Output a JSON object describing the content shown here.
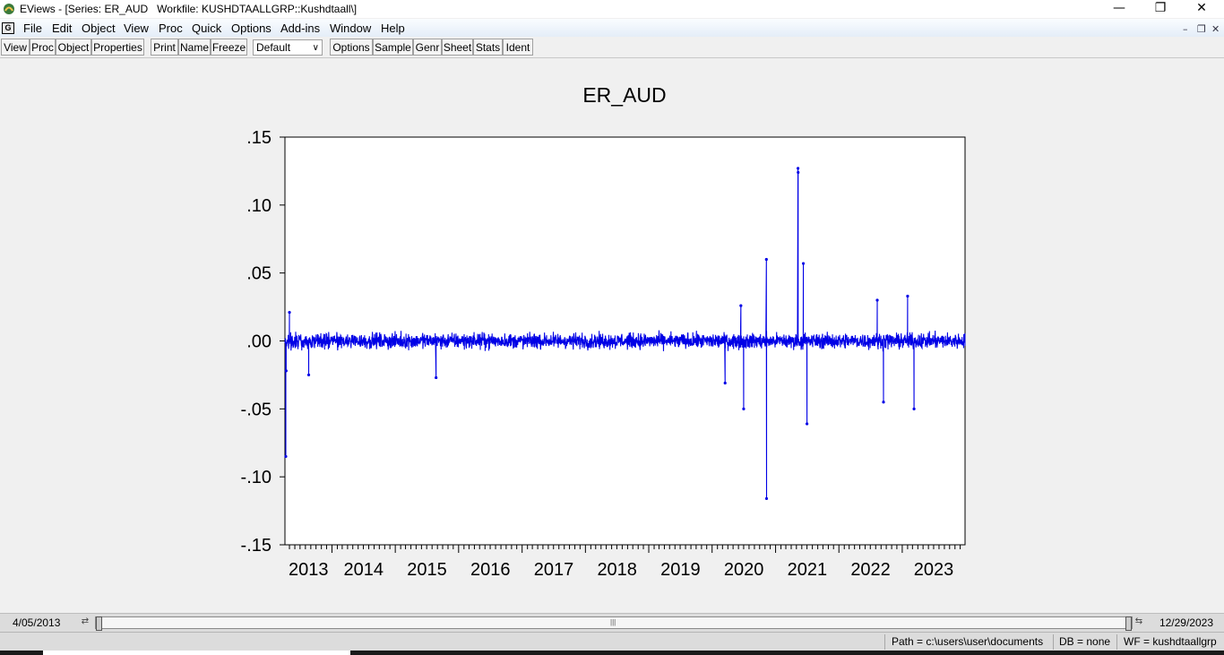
{
  "window": {
    "title": "EViews - [Series: ER_AUD   Workfile: KUSHDTAALLGRP::Kushdtaall\\]",
    "controls": [
      "—",
      "❐",
      "✕"
    ]
  },
  "menubar": {
    "icon_letter": "G",
    "items": [
      "File",
      "Edit",
      "Object",
      "View",
      "Proc",
      "Quick",
      "Options",
      "Add-ins",
      "Window",
      "Help"
    ],
    "mdi_controls": [
      "–",
      "❐",
      "✕"
    ]
  },
  "toolbar": {
    "buttons_left": [
      "View",
      "Proc",
      "Object",
      "Properties",
      "Print",
      "Name",
      "Freeze"
    ],
    "select_value": "Default",
    "buttons_right": [
      "Options",
      "Sample",
      "Genr",
      "Sheet",
      "Stats",
      "Ident"
    ]
  },
  "chart_data": {
    "type": "line",
    "title": "ER_AUD",
    "xlabel": "",
    "ylabel": "",
    "x_range": [
      "2013-04-05",
      "2023-12-29"
    ],
    "ylim": [
      -0.15,
      0.15
    ],
    "y_ticks": [
      ".15",
      ".10",
      ".05",
      ".00",
      "-.05",
      "-.10",
      "-.15"
    ],
    "y_tick_values": [
      0.15,
      0.1,
      0.05,
      0.0,
      -0.05,
      -0.1,
      -0.15
    ],
    "x_tick_labels": [
      "2013",
      "2014",
      "2015",
      "2016",
      "2017",
      "2018",
      "2019",
      "2020",
      "2021",
      "2022",
      "2023"
    ],
    "grid": false,
    "series": [
      {
        "color": "#0000e6",
        "typical_band": {
          "min": -0.015,
          "max": 0.015
        },
        "notable_points": [
          {
            "date": "2013-04-10",
            "value": -0.085
          },
          {
            "date": "2013-04-12",
            "value": -0.022
          },
          {
            "date": "2013-05-01",
            "value": 0.021
          },
          {
            "date": "2013-08-20",
            "value": -0.025
          },
          {
            "date": "2015-08-24",
            "value": -0.027
          },
          {
            "date": "2020-03-16",
            "value": -0.031
          },
          {
            "date": "2020-06-15",
            "value": 0.026
          },
          {
            "date": "2020-07-01",
            "value": -0.05
          },
          {
            "date": "2020-11-09",
            "value": 0.06
          },
          {
            "date": "2020-11-10",
            "value": -0.116
          },
          {
            "date": "2021-05-10",
            "value": 0.127
          },
          {
            "date": "2021-05-11",
            "value": 0.124
          },
          {
            "date": "2021-06-10",
            "value": 0.057
          },
          {
            "date": "2021-07-01",
            "value": -0.061
          },
          {
            "date": "2022-08-10",
            "value": 0.03
          },
          {
            "date": "2022-09-15",
            "value": -0.045
          },
          {
            "date": "2023-02-01",
            "value": 0.033
          },
          {
            "date": "2023-03-10",
            "value": -0.05
          }
        ]
      }
    ]
  },
  "sample_bar": {
    "start": "4/05/2013",
    "end": "12/29/2023",
    "grip": "|||"
  },
  "status": {
    "path": "Path = c:\\users\\user\\documents",
    "db": "DB = none",
    "wf": "WF = kushdtaallgrp"
  }
}
